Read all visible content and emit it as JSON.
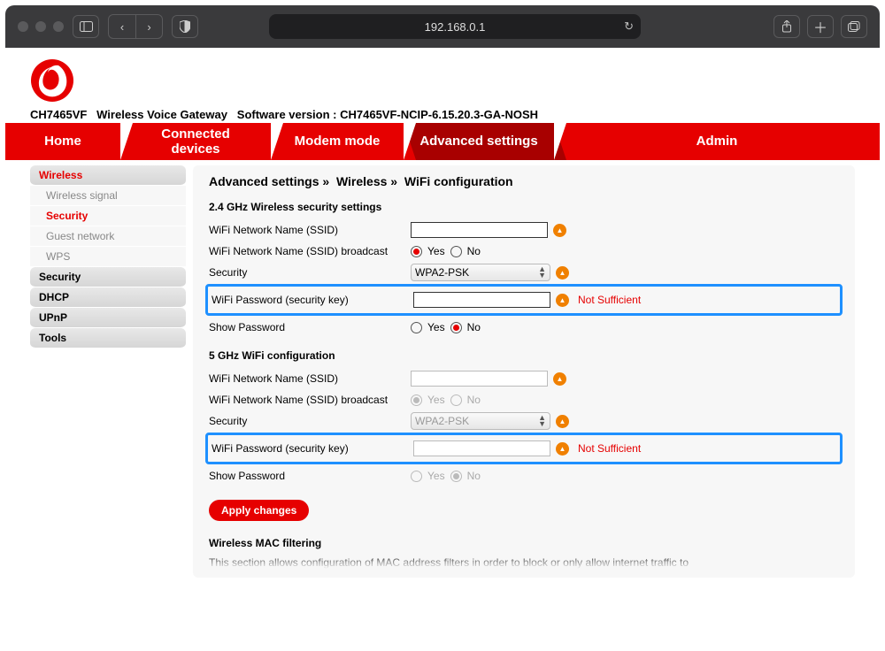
{
  "chrome": {
    "url": "192.168.0.1"
  },
  "device": {
    "model": "CH7465VF",
    "type": "Wireless Voice Gateway",
    "software_label": "Software version :",
    "software": "CH7465VF-NCIP-6.15.20.3-GA-NOSH"
  },
  "nav": {
    "home": "Home",
    "connected": "Connected devices",
    "modem": "Modem mode",
    "advanced": "Advanced settings",
    "admin": "Admin"
  },
  "sidebar": {
    "wireless": "Wireless",
    "wireless_signal": "Wireless signal",
    "security": "Security",
    "guest_network": "Guest network",
    "wps": "WPS",
    "sec": "Security",
    "dhcp": "DHCP",
    "upnp": "UPnP",
    "tools": "Tools"
  },
  "breadcrumb": {
    "p1": "Advanced settings »",
    "p2": "Wireless »",
    "p3": "WiFi configuration"
  },
  "sections": {
    "s24": "2.4 GHz Wireless security settings",
    "s5": "5 GHz WiFi configuration",
    "mac": "Wireless MAC filtering"
  },
  "labels": {
    "ssid": "WiFi Network Name (SSID)",
    "broadcast": "WiFi Network Name (SSID) broadcast",
    "security": "Security",
    "password": "WiFi Password (security key)",
    "show_password": "Show Password",
    "yes": "Yes",
    "no": "No"
  },
  "values": {
    "security_mode": "WPA2-PSK",
    "not_sufficient": "Not Sufficient"
  },
  "buttons": {
    "apply": "Apply changes"
  },
  "text": {
    "mac_desc": "This section allows configuration of MAC address filters in order to block or only allow internet traffic to"
  }
}
